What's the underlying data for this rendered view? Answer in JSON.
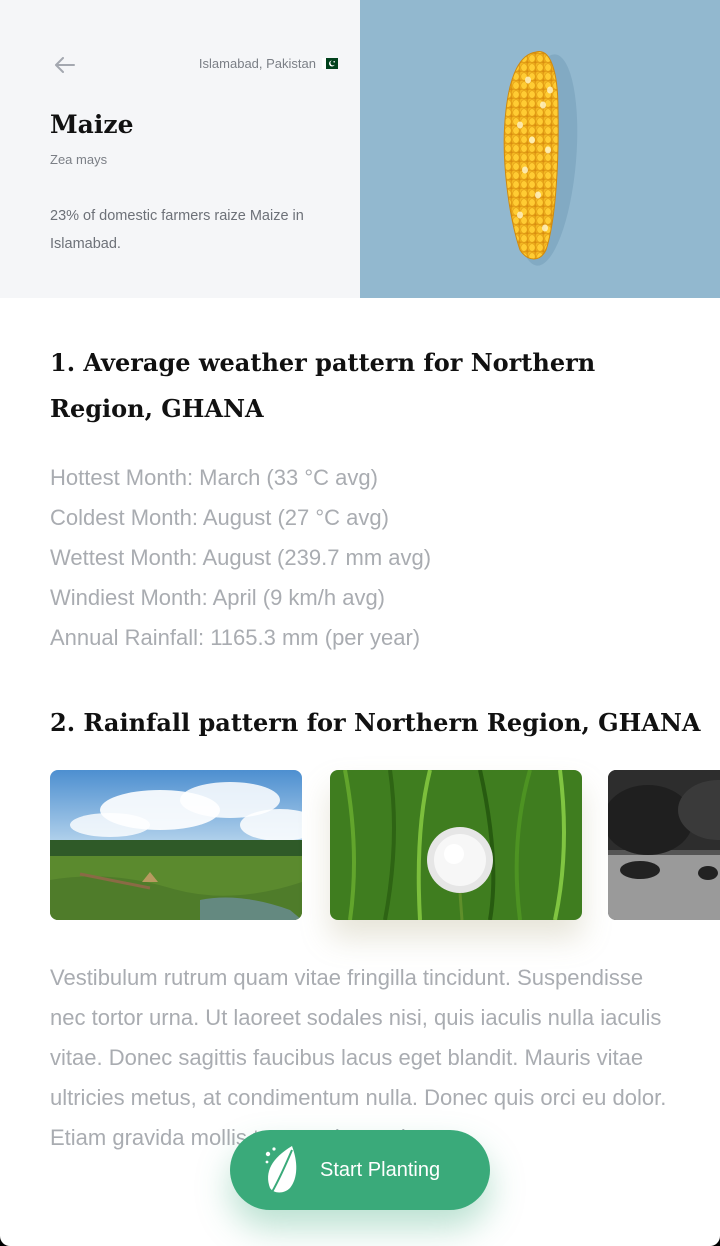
{
  "header": {
    "back_icon": "arrow-left-icon",
    "location": "Islamabad, Pakistan",
    "flag_icon": "pakistan-flag-icon",
    "crop_name": "Maize",
    "scientific_name": "Zea mays",
    "description": "23% of domestic farmers raize Maize in Islamabad.",
    "image": "corn-cob-on-blue-background"
  },
  "section1": {
    "title": "1. Average weather pattern for Northern Region, GHANA",
    "items": [
      "Hottest Month: March (33 °C avg)",
      "Coldest Month: August (27 °C avg)",
      "Wettest Month: August (239.7 mm avg)",
      "Windiest Month: April (9 km/h avg)",
      "Annual Rainfall: 1165.3 mm (per year)"
    ]
  },
  "section2": {
    "title": "2. Rainfall pattern for Northern Region, GHANA",
    "photos": [
      "wetland-landscape-photo",
      "dandelion-in-grass-photo",
      "grazing-cattle-bw-photo"
    ],
    "body": "Vestibulum rutrum quam vitae fringilla tincidunt. Suspendisse nec tortor urna. Ut laoreet sodales nisi, quis iaculis nulla iaculis vitae. Donec sagittis faucibus lacus eget blandit. Mauris vitae ultricies metus, at condimentum nulla. Donec quis orci eu dolor. Etiam gravida mollis tortor quis porttitor."
  },
  "cta": {
    "label": "Start Planting",
    "icon": "leaf-icon"
  },
  "colors": {
    "accent": "#3aaa7a",
    "header_bg": "#f5f6f8",
    "image_bg": "#92b8cf",
    "muted_text": "#a9acb1"
  }
}
